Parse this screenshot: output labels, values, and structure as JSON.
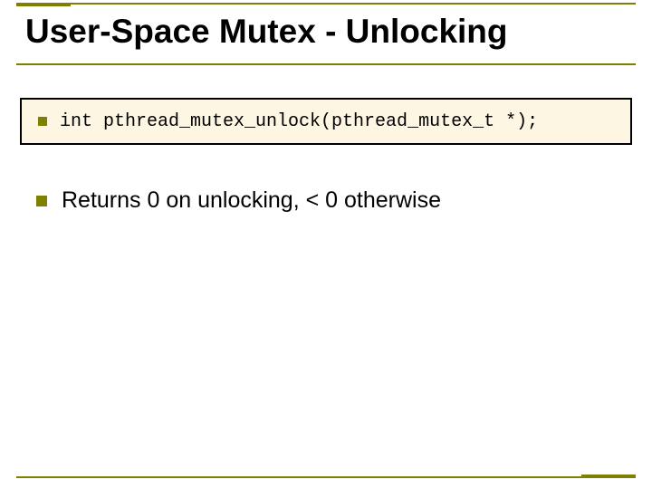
{
  "slide": {
    "title": "User-Space Mutex - Unlocking",
    "code_line": "int pthread_mutex_unlock(pthread_mutex_t *);",
    "body_line": "Returns 0 on unlocking, < 0 otherwise"
  },
  "colors": {
    "accent": "#808000",
    "code_bg": "#fdf6e3",
    "text": "#000000"
  }
}
